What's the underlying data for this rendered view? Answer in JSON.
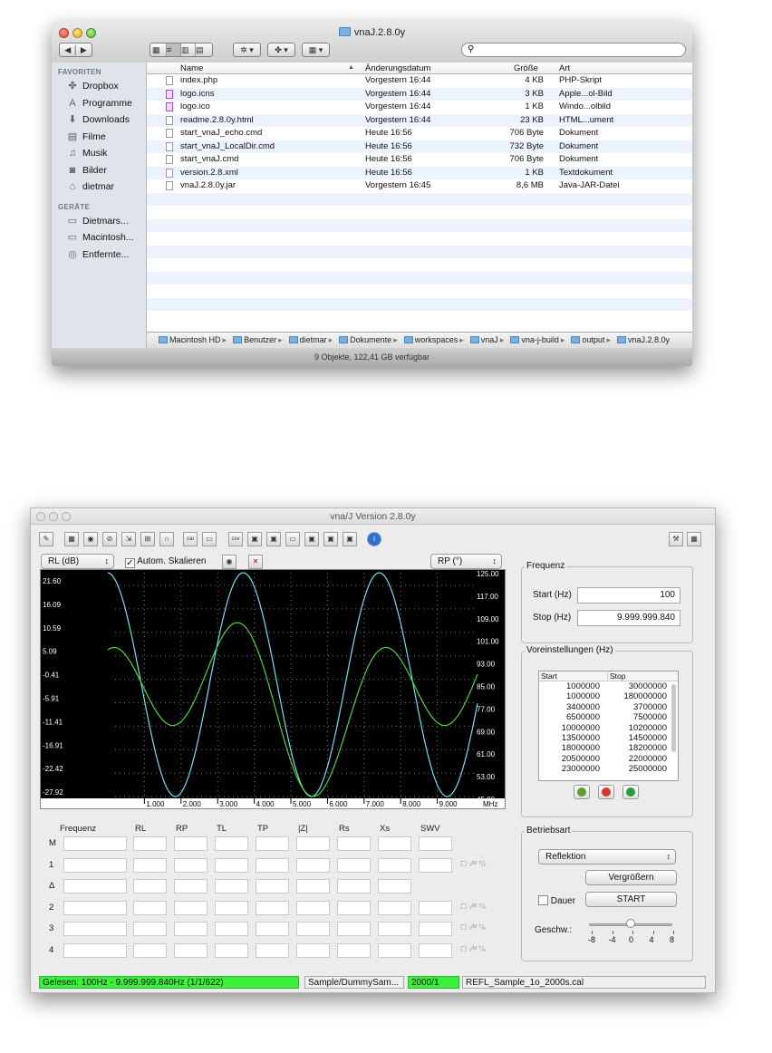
{
  "finder": {
    "title": "vnaJ.2.8.0y",
    "search_placeholder": "",
    "sidebar": {
      "favorites_header": "FAVORITEN",
      "favorites": [
        {
          "label": "Dropbox",
          "icon": "dropbox-icon",
          "glyph": "✤"
        },
        {
          "label": "Programme",
          "icon": "applications-icon",
          "glyph": "A"
        },
        {
          "label": "Downloads",
          "icon": "downloads-icon",
          "glyph": "⬇"
        },
        {
          "label": "Filme",
          "icon": "movies-icon",
          "glyph": "▤"
        },
        {
          "label": "Musik",
          "icon": "music-icon",
          "glyph": "♫"
        },
        {
          "label": "Bilder",
          "icon": "pictures-icon",
          "glyph": "◙"
        },
        {
          "label": "dietmar",
          "icon": "home-icon",
          "glyph": "⌂"
        }
      ],
      "devices_header": "GERÄTE",
      "devices": [
        {
          "label": "Dietmars...",
          "icon": "disk-icon",
          "glyph": "▭"
        },
        {
          "label": "Macintosh...",
          "icon": "hard-disk-icon",
          "glyph": "▭"
        },
        {
          "label": "Entfernte...",
          "icon": "remote-disc-icon",
          "glyph": "◎"
        }
      ]
    },
    "columns": {
      "name": "Name",
      "date": "Änderungsdatum",
      "size": "Größe",
      "kind": "Art"
    },
    "files": [
      {
        "name": "index.php",
        "date": "Vorgestern 16:44",
        "size": "4 KB",
        "kind": "PHP-Skript"
      },
      {
        "name": "logo.icns",
        "date": "Vorgestern 16:44",
        "size": "3 KB",
        "kind": "Apple...ol-Bild"
      },
      {
        "name": "logo.ico",
        "date": "Vorgestern 16:44",
        "size": "1 KB",
        "kind": "Windo...olbild"
      },
      {
        "name": "readme.2.8.0y.html",
        "date": "Vorgestern 16:44",
        "size": "23 KB",
        "kind": "HTML...ument"
      },
      {
        "name": "start_vnaJ_echo.cmd",
        "date": "Heute 16:56",
        "size": "706 Byte",
        "kind": "Dokument"
      },
      {
        "name": "start_vnaJ_LocalDir.cmd",
        "date": "Heute 16:56",
        "size": "732 Byte",
        "kind": "Dokument"
      },
      {
        "name": "start_vnaJ.cmd",
        "date": "Heute 16:56",
        "size": "706 Byte",
        "kind": "Dokument"
      },
      {
        "name": "version.2.8.xml",
        "date": "Heute 16:56",
        "size": "1 KB",
        "kind": "Textdokument"
      },
      {
        "name": "vnaJ.2.8.0y.jar",
        "date": "Vorgestern 16:45",
        "size": "8,6 MB",
        "kind": "Java-JAR-Datei"
      }
    ],
    "path": [
      "Macintosh HD",
      "Benutzer",
      "dietmar",
      "Dokumente",
      "workspaces",
      "vnaJ",
      "vna-j-build",
      "output",
      "vnaJ.2.8.0y"
    ],
    "status": "9 Objekte, 122,41 GB verfügbar"
  },
  "vna": {
    "title": "vna/J Version 2.8.0y",
    "left_combo": "RL (dB)",
    "autoscale_label": "Autom. Skalieren",
    "right_combo": "RP (°)",
    "left_ticks": [
      "21.60",
      "16.09",
      "10.59",
      "5.09",
      "-0.41",
      "-5.91",
      "-11.41",
      "-16.91",
      "-22.42",
      "-27.92"
    ],
    "right_ticks": [
      "125.00",
      "117.00",
      "109.00",
      "101.00",
      "93.00",
      "85.00",
      "77.00",
      "69.00",
      "61.00",
      "53.00",
      "45.00"
    ],
    "x_ticks": [
      "1.000",
      "2.000",
      "3.000",
      "4.000",
      "5.000",
      "6.000",
      "7.000",
      "8.000",
      "9.000"
    ],
    "x_unit": "MHz",
    "marker_headers": [
      "Frequenz",
      "RL",
      "RP",
      "TL",
      "TP",
      "|Z|",
      "Rs",
      "Xs",
      "SWV"
    ],
    "marker_rows": [
      "M",
      "1",
      "Δ",
      "2",
      "3",
      "4"
    ],
    "frequency": {
      "title": "Frequenz",
      "start_label": "Start (Hz)",
      "start_value": "100",
      "stop_label": "Stop (Hz)",
      "stop_value": "9.999.999.840"
    },
    "presets": {
      "title": "Voreinstellungen (Hz)",
      "col_start": "Start",
      "col_stop": "Stop",
      "rows": [
        [
          "1000000",
          "30000000"
        ],
        [
          "1000000",
          "180000000"
        ],
        [
          "3400000",
          "3700000"
        ],
        [
          "6500000",
          "7500000"
        ],
        [
          "10000000",
          "10200000"
        ],
        [
          "13500000",
          "14500000"
        ],
        [
          "18000000",
          "18200000"
        ],
        [
          "20500000",
          "22000000"
        ],
        [
          "23000000",
          "25000000"
        ]
      ]
    },
    "mode": {
      "title": "Betriebsart",
      "select": "Reflektion",
      "zoom_button": "Vergrößern",
      "continuous_label": "Dauer",
      "start_button": "START",
      "speed_label": "Geschw.:",
      "speed_ticks": [
        "-8",
        "-4",
        "0",
        "4",
        "8"
      ]
    },
    "statusbar": {
      "read": "Gelesen: 100Hz - 9.999.999.840Hz (1/1/622)",
      "driver": "Sample/DummySam...",
      "samples": "2000/1",
      "cal": "REFL_Sample_1o_2000s.cal"
    },
    "colors": {
      "trace1": "#6fe0f0",
      "trace2": "#4fd43c",
      "status_green": "#3cf03c"
    }
  }
}
